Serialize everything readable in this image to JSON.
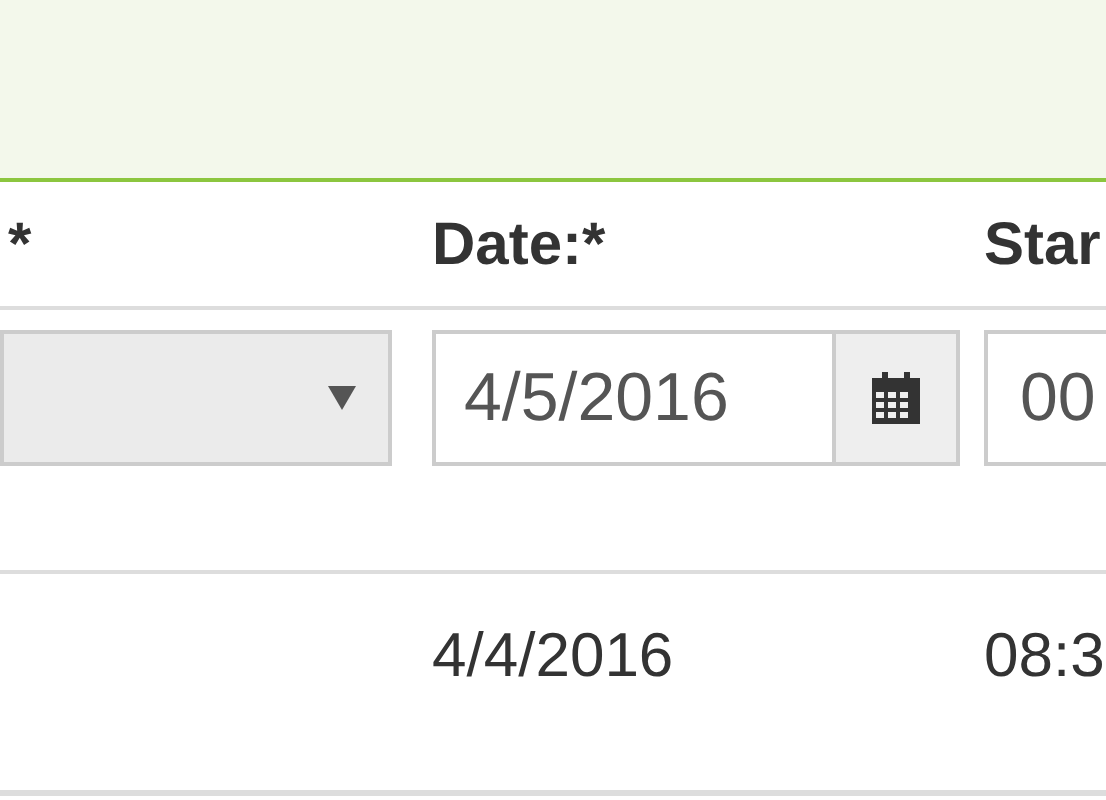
{
  "header_columns": [
    {
      "label": "*"
    },
    {
      "label": "Date:*"
    },
    {
      "label": "Star"
    }
  ],
  "form_row": {
    "date": {
      "value": "4/5/2016"
    },
    "time": {
      "value": "00"
    }
  },
  "rows": [
    {
      "date": "4/4/2016",
      "column_2": "08:3"
    }
  ]
}
